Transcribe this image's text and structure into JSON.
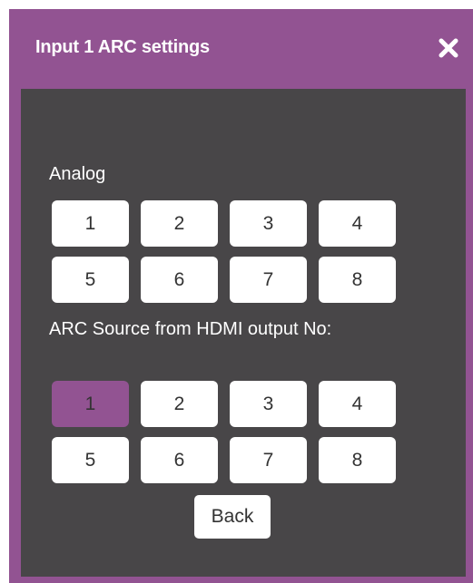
{
  "dialog": {
    "title": "Input 1 ARC settings",
    "close_icon": "close-icon",
    "accent_color": "#925392",
    "panel_color": "#484648"
  },
  "analog": {
    "label": "Analog",
    "buttons": [
      "1",
      "2",
      "3",
      "4",
      "5",
      "6",
      "7",
      "8"
    ]
  },
  "arc_source": {
    "label": "ARC Source from HDMI output No:",
    "buttons": [
      "1",
      "2",
      "3",
      "4",
      "5",
      "6",
      "7",
      "8"
    ],
    "selected": "1"
  },
  "back_label": "Back"
}
